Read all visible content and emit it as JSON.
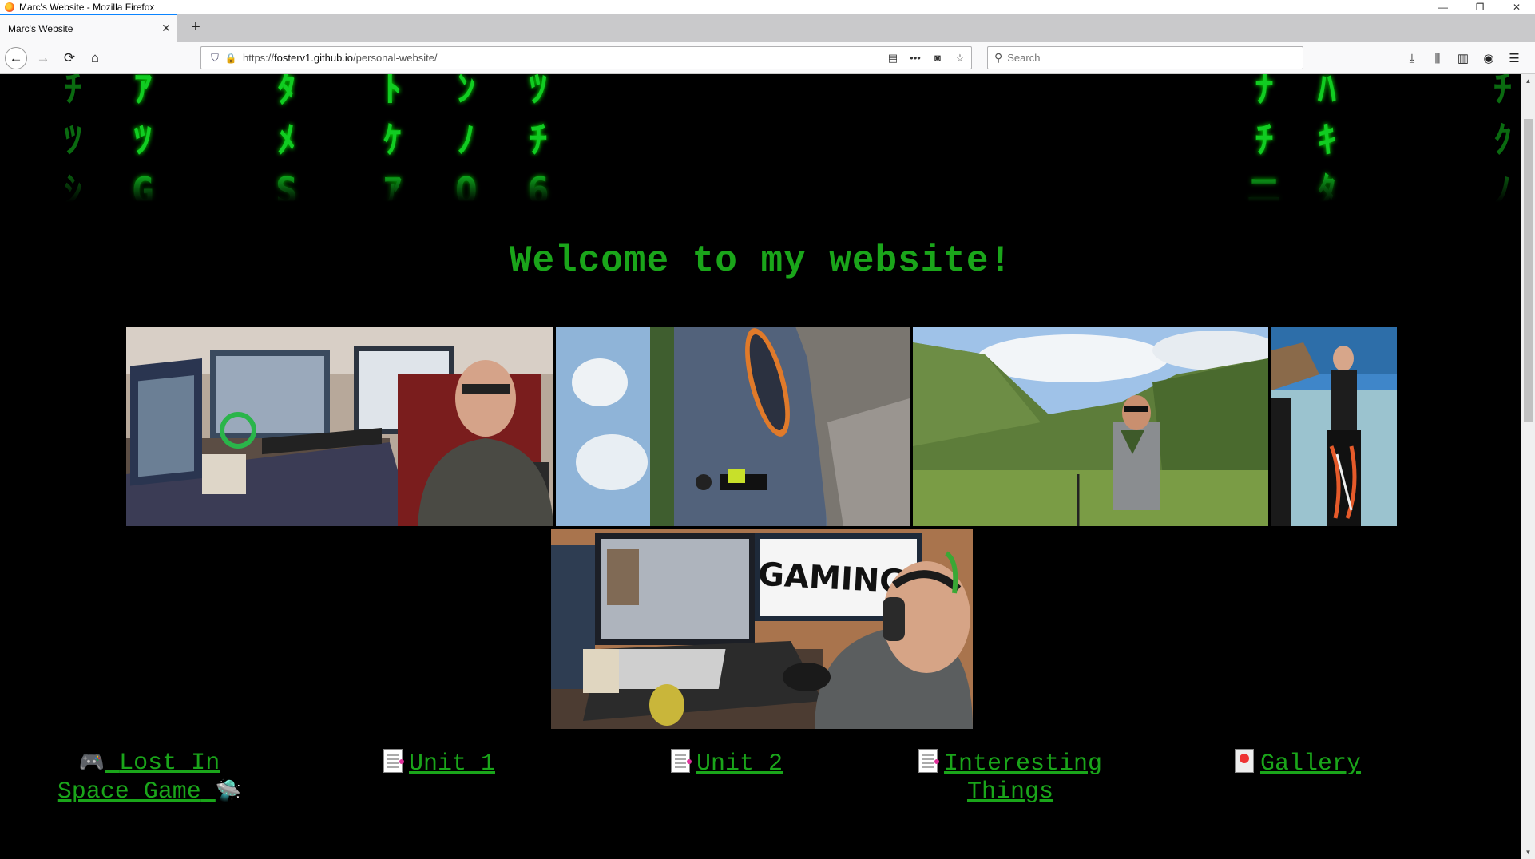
{
  "window": {
    "title": "Marc's Website - Mozilla Firefox",
    "controls": [
      "—",
      "❐",
      "✕"
    ]
  },
  "tabs": [
    {
      "title": "Marc's Website",
      "active": true
    }
  ],
  "nav": {
    "url_prefix": "https://",
    "url_host": "fosterv1.github.io",
    "url_path": "/personal-website/",
    "search_placeholder": "Search"
  },
  "matrix": {
    "color": "#11cc22",
    "columns": [
      {
        "chars": [
          "ﾁ",
          "ﾂ",
          "ｼ"
        ],
        "dim": true
      },
      {
        "chars": [
          "ｱ",
          "ﾂ",
          "G"
        ],
        "dim": false
      },
      {
        "chars": [
          "ﾀ",
          "ﾒ",
          "S"
        ],
        "dim": false
      },
      {
        "chars": [
          "ﾄ",
          "ｹ",
          "ｱ"
        ],
        "dim": false
      },
      {
        "chars": [
          "ﾝ",
          "ﾉ",
          "Q"
        ],
        "dim": false
      },
      {
        "chars": [
          "ﾂ",
          "ﾁ",
          "6"
        ],
        "dim": false
      },
      {
        "chars": [
          "ﾅ",
          "ﾁ",
          "ニ"
        ],
        "dim": false
      },
      {
        "chars": [
          "ﾊ",
          "ｷ",
          "ﾀ"
        ],
        "dim": false
      },
      {
        "chars": [
          "ﾁ",
          "ｸ",
          "ﾉ"
        ],
        "dim": true
      }
    ]
  },
  "page": {
    "heading": "Welcome to my website!",
    "accent": "#1aa51a",
    "photos": [
      {
        "subject": "desk-setup-photo"
      },
      {
        "subject": "paddleboard-lake-photo"
      },
      {
        "subject": "mountain-hiking-photo"
      },
      {
        "subject": "beach-wakeboard-photo"
      },
      {
        "subject": "gaming-setup-photo",
        "sign": "GAMING!"
      }
    ],
    "links": [
      {
        "icon": "gamepad-icon",
        "label_1": "Lost In",
        "label_2": "Space Game",
        "trail_icon": "ufo-icon"
      },
      {
        "icon": "document-icon",
        "label": "Unit 1"
      },
      {
        "icon": "document-icon",
        "label": "Unit 2"
      },
      {
        "icon": "document-icon",
        "label_1": "Interesting",
        "label_2": "Things"
      },
      {
        "icon": "gallery-icon",
        "label": "Gallery"
      }
    ]
  }
}
